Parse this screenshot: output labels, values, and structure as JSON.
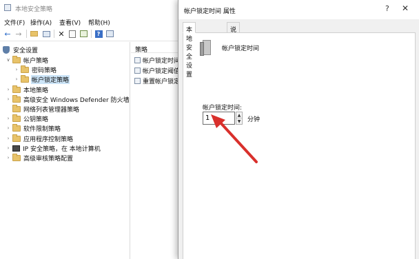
{
  "mmc": {
    "title": "本地安全策略",
    "menu": [
      "文件(F)",
      "操作(A)",
      "查看(V)",
      "帮助(H)"
    ],
    "toolbar_icons": [
      "back-icon",
      "forward-icon",
      "up-folder-icon",
      "show-tree-icon",
      "delete-icon",
      "properties-icon",
      "export-icon",
      "help-icon",
      "console-icon"
    ],
    "tree": {
      "root": "安全设置",
      "items": [
        {
          "label": "帐户策略",
          "level": 1,
          "expanded": true
        },
        {
          "label": "密码策略",
          "level": 2
        },
        {
          "label": "帐户锁定策略",
          "level": 2,
          "selected": true
        },
        {
          "label": "本地策略",
          "level": 1
        },
        {
          "label": "高级安全 Windows Defender 防火墙",
          "level": 1
        },
        {
          "label": "网络列表管理器策略",
          "level": 1
        },
        {
          "label": "公钥策略",
          "level": 1
        },
        {
          "label": "软件限制策略",
          "level": 1
        },
        {
          "label": "应用程序控制策略",
          "level": 1
        },
        {
          "label": "IP 安全策略，在 本地计算机",
          "level": 1
        },
        {
          "label": "高级审核策略配置",
          "level": 1
        }
      ]
    },
    "list": {
      "header": "策略",
      "items": [
        "帐户锁定时间",
        "帐户锁定阈值",
        "重置帐户锁定"
      ]
    }
  },
  "dialog": {
    "title": "帐户锁定时间 属性",
    "help_glyph": "?",
    "close_glyph": "✕",
    "tabs": [
      "本地安全设置",
      "说明"
    ],
    "active_tab": 0,
    "policy_name": "帐户锁定时间",
    "field_label": "帐户锁定时间:",
    "lockout_value": "1",
    "unit_label": "分钟"
  },
  "annotation": {
    "arrow_color": "#d9302c"
  }
}
